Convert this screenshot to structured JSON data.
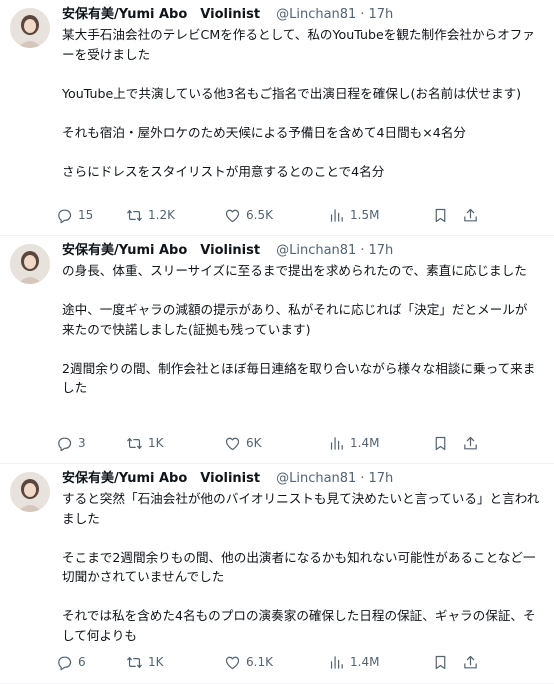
{
  "tweets": [
    {
      "author_name": "安保有美/Yumi Abo　Violinist",
      "handle": "@Linchan81",
      "separator": "·",
      "time": "17h",
      "paragraphs": [
        "某大手石油会社のテレビCMを作るとして、私のYouTubeを観た制作会社からオファーを受けました",
        "YouTube上で共演している他3名もご指名で出演日程を確保し(お名前は伏せます)",
        "それも宿泊・屋外ロケのため天候による予備日を含めて4日間も×4名分",
        "さらにドレスをスタイリストが用意するとのことで4名分"
      ],
      "replies": "15",
      "retweets": "1.2K",
      "likes": "6.5K",
      "views": "1.5M"
    },
    {
      "author_name": "安保有美/Yumi Abo　Violinist",
      "handle": "@Linchan81",
      "separator": "·",
      "time": "17h",
      "paragraphs": [
        "の身長、体重、スリーサイズに至るまで提出を求められたので、素直に応じました",
        "途中、一度ギャラの減額の提示があり、私がそれに応じれば「決定」だとメールが来たので快諾しました(証拠も残っています)",
        "2週間余りの間、制作会社とほぼ毎日連絡を取り合いながら様々な相談に乗って来ました"
      ],
      "replies": "3",
      "retweets": "1K",
      "likes": "6K",
      "views": "1.4M"
    },
    {
      "author_name": "安保有美/Yumi Abo　Violinist",
      "handle": "@Linchan81",
      "separator": "·",
      "time": "17h",
      "paragraphs": [
        "すると突然「石油会社が他のバイオリニストも見て決めたいと言っている」と言われました",
        "そこまで2週間余りもの間、他の出演者になるかも知れない可能性があることなど一切聞かされていませんでした",
        "それでは私を含めた4名ものプロの演奏家の確保した日程の保証、ギャラの保証、そして何よりも"
      ],
      "replies": "6",
      "retweets": "1K",
      "likes": "6.1K",
      "views": "1.4M"
    }
  ],
  "icons": {
    "reply": "reply-icon",
    "retweet": "retweet-icon",
    "like": "heart-icon",
    "views": "views-chart-icon",
    "bookmark": "bookmark-icon",
    "share": "share-icon"
  },
  "colors": {
    "text": "#0f1419",
    "secondary": "#536471",
    "divider": "#eff3f4"
  }
}
